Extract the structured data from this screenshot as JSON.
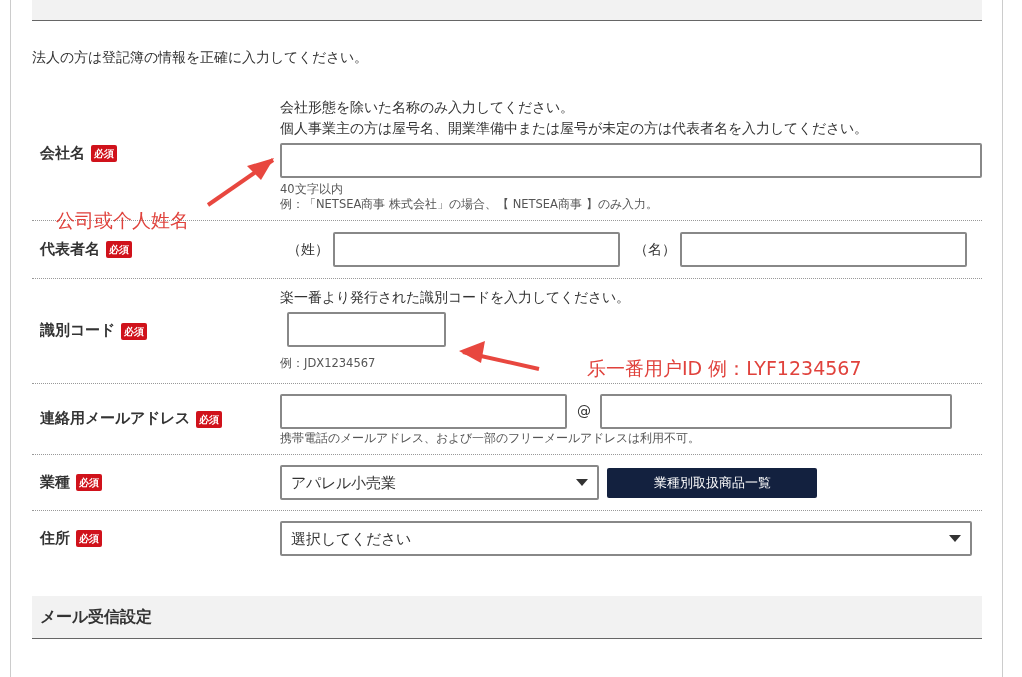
{
  "intro": "法人の方は登記簿の情報を正確に入力してください。",
  "rows": [
    {
      "kind": "text",
      "label": "会社名",
      "badge": "必須",
      "hints": [
        "会社形態を除いた名称のみ入力してください。",
        "個人事業主の方は屋号名、開業準備中または屋号が未定の方は代表者名を入力してください。"
      ],
      "notes": [
        "40文字以内",
        "例：「NETSEA商事 株式会社」の場合、【 NETSEA商事 】のみ入力。"
      ]
    },
    {
      "kind": "name",
      "label": "代表者名",
      "badge": "必須",
      "parts": [
        "（姓）",
        "（名）"
      ]
    },
    {
      "kind": "code",
      "label": "識別コード",
      "badge": "必須",
      "hints": [
        "楽一番より発行された識別コードを入力してください。"
      ],
      "notes": [
        "例：JDX1234567"
      ]
    },
    {
      "kind": "email",
      "label": "連絡用メールアドレス",
      "badge": "必須",
      "separator": "@",
      "notes": [
        "携帯電話のメールアドレス、および一部のフリーメールアドレスは利用不可。"
      ]
    },
    {
      "kind": "select",
      "label": "業種",
      "badge": "必須",
      "value": "アパレル小売業",
      "button": "業種別取扱商品一覧"
    },
    {
      "kind": "select",
      "label": "住所",
      "badge": "必須",
      "value": "選択してください"
    }
  ],
  "section": "メール受信設定",
  "annotations": [
    {
      "text": "公司或个人姓名"
    },
    {
      "text": "乐一番用户ID 例：LYF1234567"
    }
  ]
}
